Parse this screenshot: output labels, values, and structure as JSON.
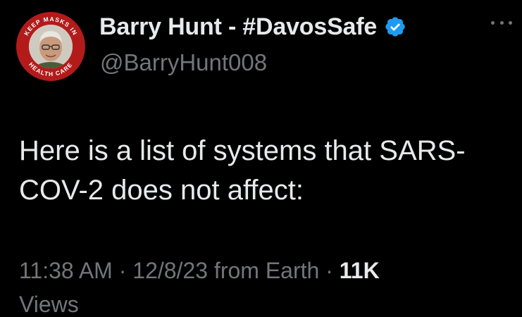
{
  "author": {
    "display_name": "Barry Hunt - #DavosSafe",
    "handle": "@BarryHunt008",
    "avatar_ring_text_top": "KEEP MASKS IN",
    "avatar_ring_text_bottom": "HEALTH CARE",
    "verified_icon": "verified-badge-icon",
    "verified_color": "#1d9bf0",
    "avatar_ring_color": "#b31b1b"
  },
  "more_icon": "more-options-icon",
  "tweet": {
    "text_line1": "Here is a list of systems that SARS-",
    "text_line2": "COV-2 does not affect:"
  },
  "meta": {
    "time": "11:38 AM",
    "sep1": " · ",
    "date": "12/8/23",
    "location": " from Earth",
    "sep2": " · ",
    "views_count": "11K",
    "views_label": "Views"
  },
  "colors": {
    "background": "#000000",
    "primary_text": "#e7e9ea",
    "secondary_text": "#71767b"
  }
}
